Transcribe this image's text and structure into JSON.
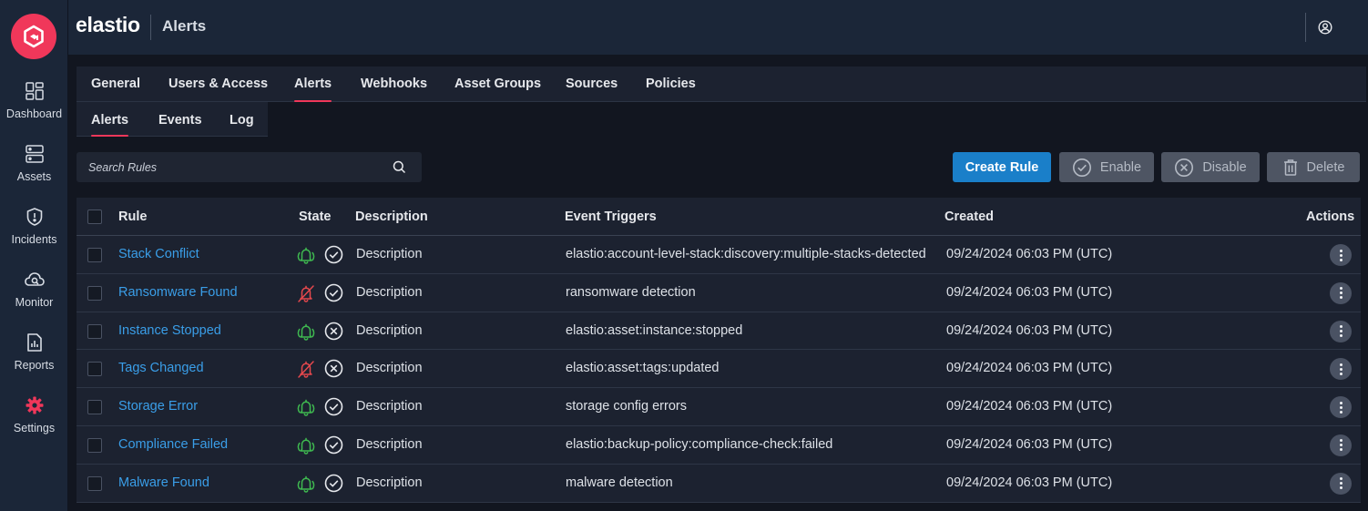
{
  "app": {
    "brand": "elastio",
    "page_title": "Alerts"
  },
  "colors": {
    "accent": "#f0375a",
    "link": "#3a9ee8",
    "primary_button": "#1a7fc9",
    "sidebar": "#1b2638",
    "bell_on": "#3fb950",
    "bell_off": "#e5484d"
  },
  "sidebar": {
    "items": [
      {
        "label": "Dashboard",
        "icon": "dashboard-icon"
      },
      {
        "label": "Assets",
        "icon": "assets-icon"
      },
      {
        "label": "Incidents",
        "icon": "shield-alert-icon"
      },
      {
        "label": "Monitor",
        "icon": "monitor-cloud-icon"
      },
      {
        "label": "Reports",
        "icon": "reports-icon"
      },
      {
        "label": "Settings",
        "icon": "gear-icon",
        "active": true
      }
    ]
  },
  "tabs": [
    "General",
    "Users & Access",
    "Alerts",
    "Webhooks",
    "Asset Groups",
    "Sources",
    "Policies"
  ],
  "active_tab": "Alerts",
  "subtabs": [
    "Alerts",
    "Events",
    "Log"
  ],
  "active_subtab": "Alerts",
  "search": {
    "placeholder": "Search Rules"
  },
  "toolbar": {
    "create_label": "Create Rule",
    "enable_label": "Enable",
    "disable_label": "Disable",
    "delete_label": "Delete"
  },
  "table": {
    "headers": {
      "rule": "Rule",
      "state": "State",
      "description": "Description",
      "triggers": "Event Triggers",
      "created": "Created",
      "actions": "Actions"
    },
    "rows": [
      {
        "rule": "Stack Conflict",
        "bell": "on",
        "status": "enabled",
        "description": "Description",
        "triggers": "elastio:account-level-stack:discovery:multiple-stacks-detected",
        "created": "09/24/2024 06:03 PM (UTC)"
      },
      {
        "rule": "Ransomware Found",
        "bell": "off",
        "status": "enabled",
        "description": "Description",
        "triggers": "ransomware detection",
        "created": "09/24/2024 06:03 PM (UTC)"
      },
      {
        "rule": "Instance Stopped",
        "bell": "on",
        "status": "disabled",
        "description": "Description",
        "triggers": "elastio:asset:instance:stopped",
        "created": "09/24/2024 06:03 PM (UTC)"
      },
      {
        "rule": "Tags Changed",
        "bell": "off",
        "status": "disabled",
        "description": "Description",
        "triggers": "elastio:asset:tags:updated",
        "created": "09/24/2024 06:03 PM (UTC)"
      },
      {
        "rule": "Storage Error",
        "bell": "on",
        "status": "enabled",
        "description": "Description",
        "triggers": "storage config errors",
        "created": "09/24/2024 06:03 PM (UTC)"
      },
      {
        "rule": "Compliance Failed",
        "bell": "on",
        "status": "enabled",
        "description": "Description",
        "triggers": "elastio:backup-policy:compliance-check:failed",
        "created": "09/24/2024 06:03 PM (UTC)"
      },
      {
        "rule": "Malware Found",
        "bell": "on",
        "status": "enabled",
        "description": "Description",
        "triggers": "malware detection",
        "created": "09/24/2024 06:03 PM (UTC)"
      }
    ]
  }
}
